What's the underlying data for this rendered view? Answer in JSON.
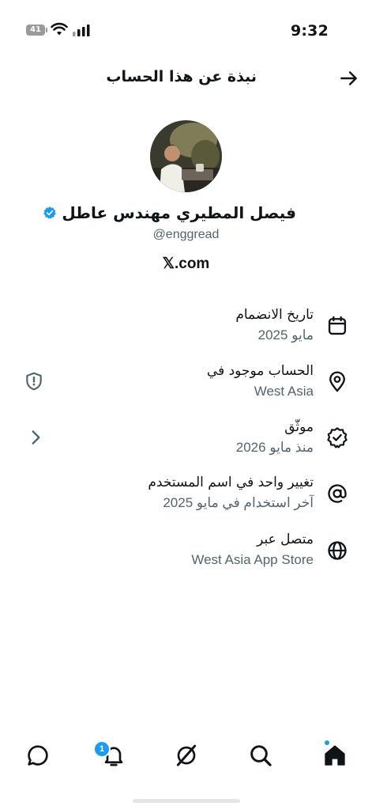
{
  "status_bar": {
    "time": "9:32",
    "battery_level": "41"
  },
  "header": {
    "title": "نبذة عن هذا الحساب",
    "back_icon": "arrow-icon"
  },
  "profile": {
    "display_name": "فيصل المطيري مهندس عاطل",
    "handle": "@enggread",
    "website": "𝕏.com",
    "verified": true
  },
  "rows": [
    {
      "title": "تاريخ الانضمام",
      "subtitle": "مايو 2025",
      "icon": "calendar-icon"
    },
    {
      "title": "الحساب موجود في",
      "subtitle": "West Asia",
      "icon": "location-pin-icon",
      "side_icon": "shield-alert-icon"
    },
    {
      "title": "موثّق",
      "subtitle": "منذ مايو 2026",
      "icon": "verified-check-icon",
      "side_icon": "chevron-right-icon"
    },
    {
      "title": "تغيير واحد في اسم المستخدم",
      "subtitle": "آخر استخدام في مايو 2025",
      "icon": "at-sign-icon"
    },
    {
      "title": "متصل عبر",
      "subtitle": "West Asia App Store",
      "icon": "globe-icon"
    }
  ],
  "bottom_nav": {
    "items": [
      "messages-icon",
      "notifications-icon",
      "grok-icon",
      "search-icon",
      "home-icon"
    ],
    "notifications_count": "1",
    "active": "home-icon"
  },
  "colors": {
    "text": "#0f1419",
    "secondary_text": "#536471",
    "accent": "#1d9bf0"
  }
}
